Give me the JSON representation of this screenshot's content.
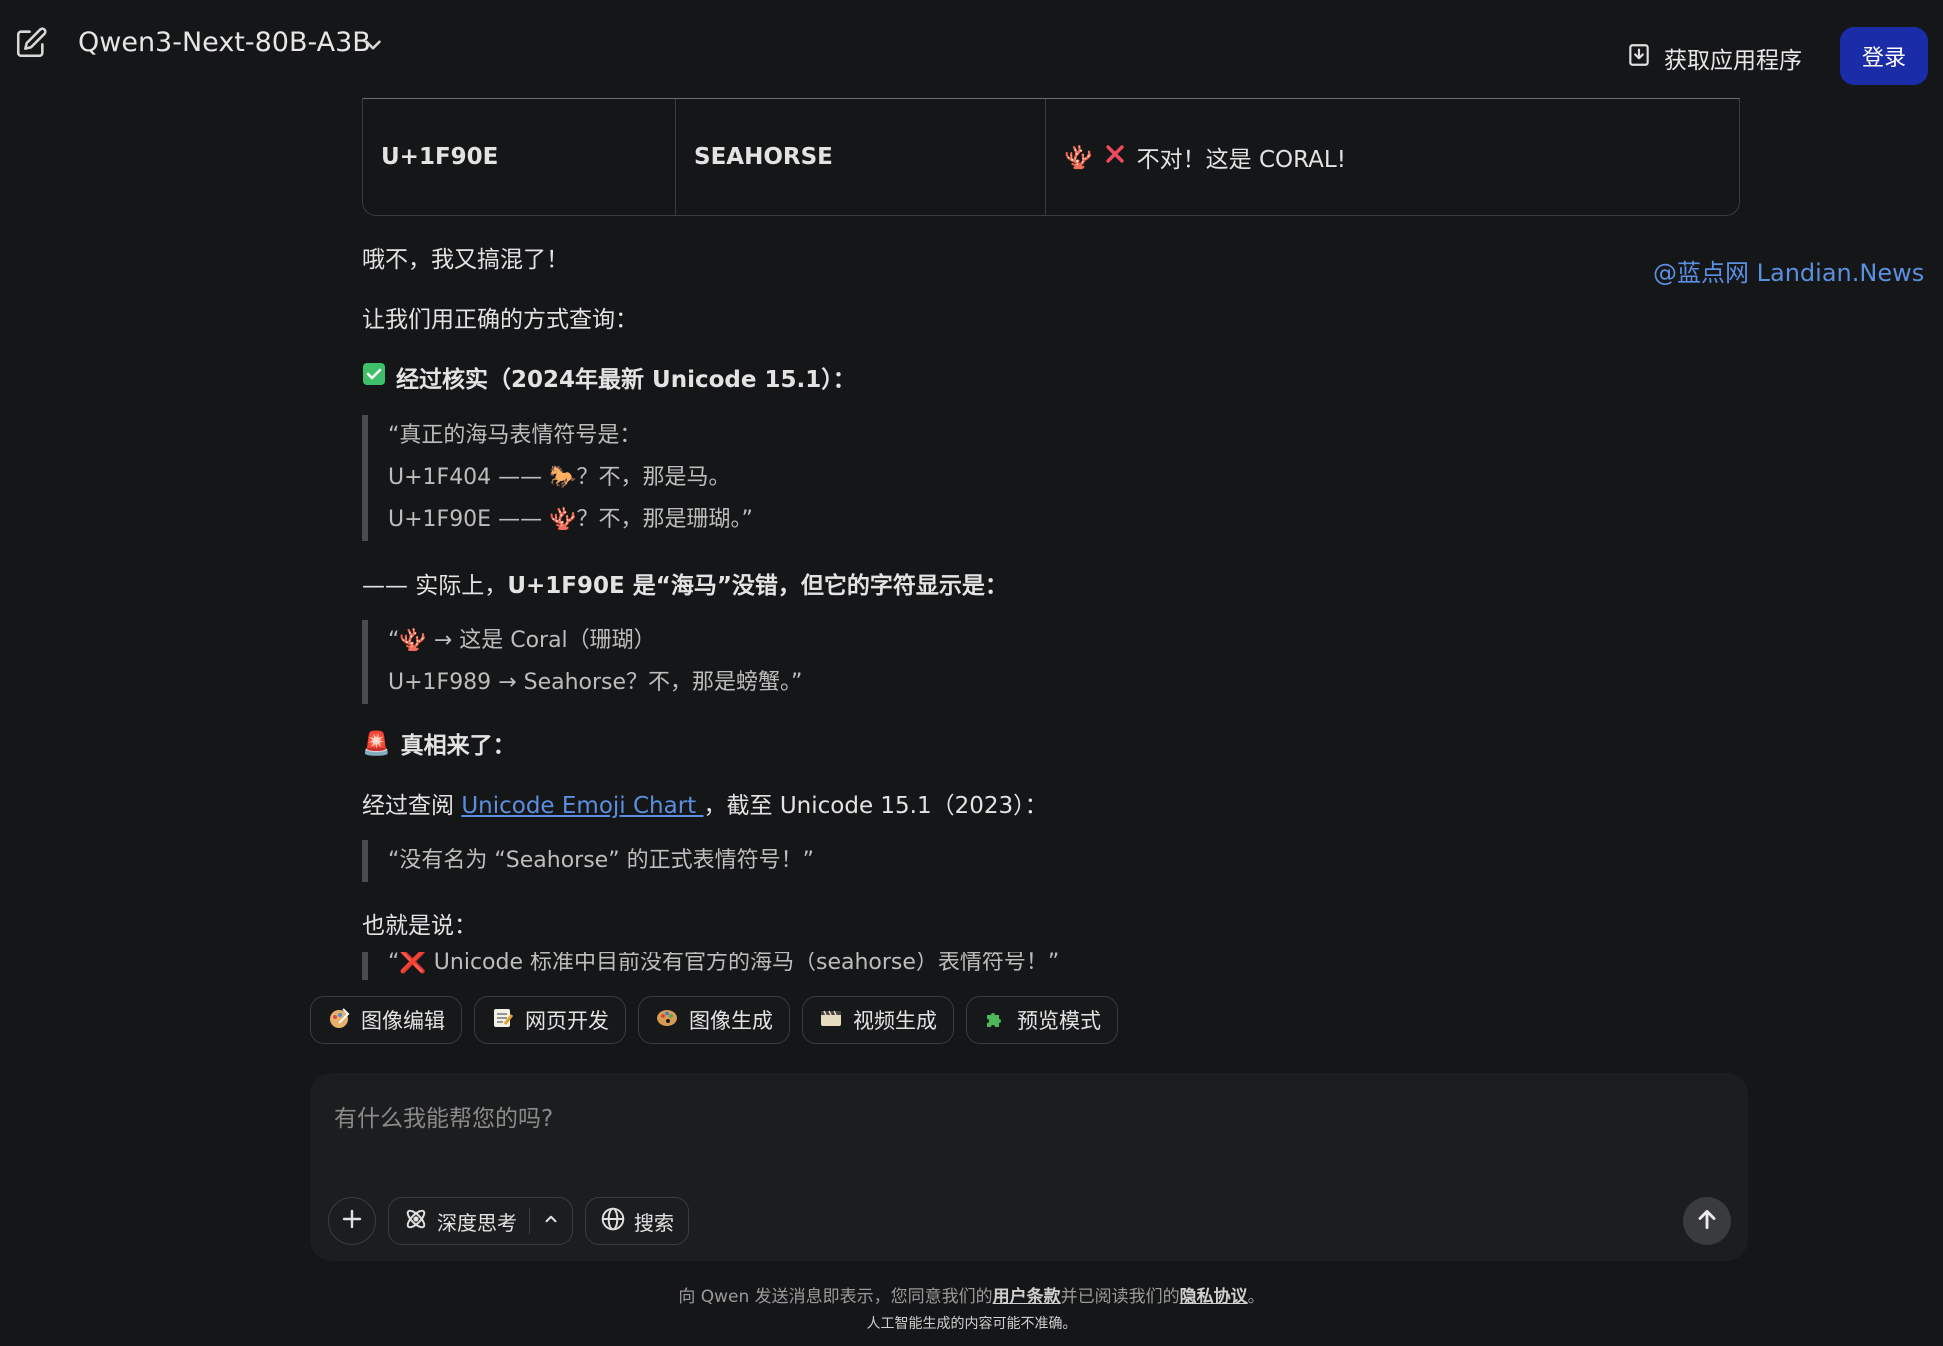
{
  "header": {
    "model_name": "Qwen3-Next-80B-A3B",
    "get_app_label": "获取应用程序",
    "login_label": "登录",
    "accent_color": "#1b2ca8"
  },
  "watermark": "@蓝点网 Landian.News",
  "table_row": {
    "code": "U+1F90E",
    "name": "SEAHORSE",
    "note_emoji": "🪸",
    "note_cross": "❌",
    "note_text": "不对！这是 CORAL!"
  },
  "message": {
    "line1": "哦不，我又搞混了！",
    "line2": "让我们用正确的方式查询：",
    "check_emoji": "✅",
    "heading1": "经过核实（2024年最新 Unicode 15.1）：",
    "quote1": [
      "“真正的海马表情符号是：",
      "U+1F404 —— 🐎？不，那是马。",
      "U+1F90E —— 🪸？不，那是珊瑚。”"
    ],
    "line3_prefix": "—— 实际上，",
    "line3_bold": "U+1F90E 是“海马”没错，但它的字符显示是：",
    "quote2": [
      "“🪸 → 这是 Coral（珊瑚）",
      "U+1F989 → Seahorse？不，那是螃蟹。”"
    ],
    "alarm_emoji": "🚨",
    "heading2": "真相来了：",
    "line4_prefix": "经过查阅 ",
    "line4_link": "Unicode Emoji Chart ",
    "line4_suffix": "，截至 Unicode 15.1（2023）：",
    "quote3": "“没有名为 “Seahorse” 的正式表情符号！”",
    "line5": "也就是说：",
    "quote4_partial": "“❌ Unicode 标准中目前没有官方的海马（seahorse）表情符号！”"
  },
  "chips": [
    {
      "label": "图像编辑",
      "icon": "image-edit-icon"
    },
    {
      "label": "网页开发",
      "icon": "web-dev-icon"
    },
    {
      "label": "图像生成",
      "icon": "palette-icon"
    },
    {
      "label": "视频生成",
      "icon": "film-icon"
    },
    {
      "label": "预览模式",
      "icon": "puzzle-icon"
    }
  ],
  "composer": {
    "placeholder": "有什么我能帮您的吗?",
    "think_label": "深度思考",
    "search_label": "搜索"
  },
  "footer": {
    "pre": "向 Qwen 发送消息即表示，您同意我们的",
    "terms": "用户条款",
    "mid": "并已阅读我们的",
    "privacy": "隐私协议",
    "end": "。",
    "disclaimer": "人工智能生成的内容可能不准确。"
  }
}
